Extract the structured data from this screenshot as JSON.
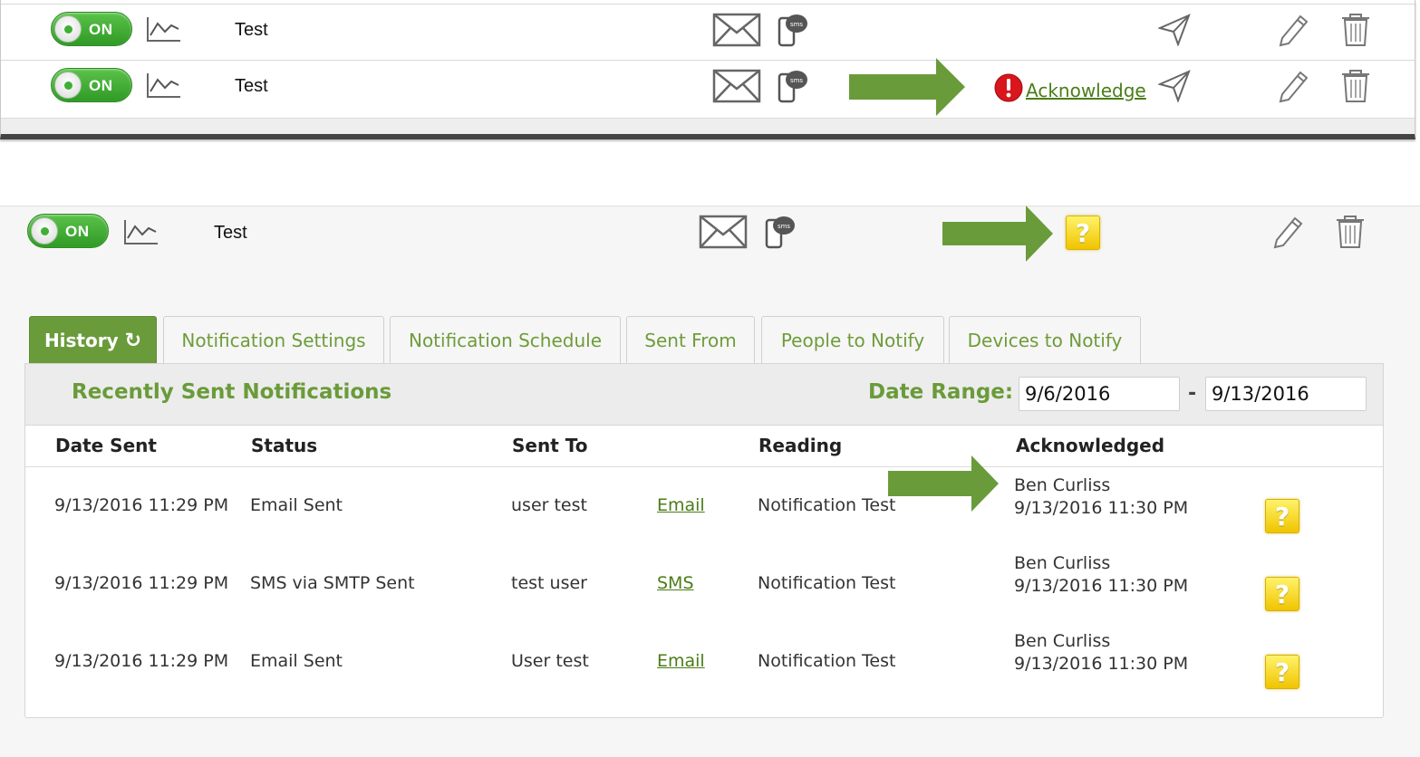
{
  "top_rows": [
    {
      "toggle": "ON",
      "name": "Test"
    },
    {
      "toggle": "ON",
      "name": "Test",
      "ack_link": "Acknowledge"
    }
  ],
  "detail_row": {
    "toggle": "ON",
    "name": "Test"
  },
  "tabs": [
    {
      "label": "History",
      "icon": "refresh-icon",
      "active": true
    },
    {
      "label": "Notification Settings"
    },
    {
      "label": "Notification Schedule"
    },
    {
      "label": "Sent From"
    },
    {
      "label": "People to Notify"
    },
    {
      "label": "Devices to Notify"
    }
  ],
  "history": {
    "title": "Recently Sent Notifications",
    "date_range_label": "Date Range:",
    "date_from": "9/6/2016",
    "date_separator": "-",
    "date_to": "9/13/2016",
    "columns": [
      "Date Sent",
      "Status",
      "Sent To",
      "Reading",
      "Acknowledged"
    ],
    "rows": [
      {
        "date_sent": "9/13/2016 11:29 PM",
        "status": "Email Sent",
        "sent_to": "user test",
        "channel": "Email",
        "reading": "Notification Test",
        "ack_by": "Ben Curliss",
        "ack_time": "9/13/2016 11:30 PM"
      },
      {
        "date_sent": "9/13/2016 11:29 PM",
        "status": "SMS via SMTP Sent",
        "sent_to": "test user",
        "channel": "SMS",
        "reading": "Notification Test",
        "ack_by": "Ben Curliss",
        "ack_time": "9/13/2016 11:30 PM"
      },
      {
        "date_sent": "9/13/2016 11:29 PM",
        "status": "Email Sent",
        "sent_to": "User test",
        "channel": "Email",
        "reading": "Notification Test",
        "ack_by": "Ben Curliss",
        "ack_time": "9/13/2016 11:30 PM"
      }
    ]
  },
  "icons": {
    "question_mark_glyph": "?",
    "alert_glyph": "!",
    "refresh_glyph": "↻"
  },
  "colors": {
    "accent_green": "#6a9b3a",
    "toggle_green": "#3eb034",
    "arrow_green": "#6a9b3a",
    "alert_red": "#d9161c",
    "question_yellow": "#f7d91a"
  }
}
